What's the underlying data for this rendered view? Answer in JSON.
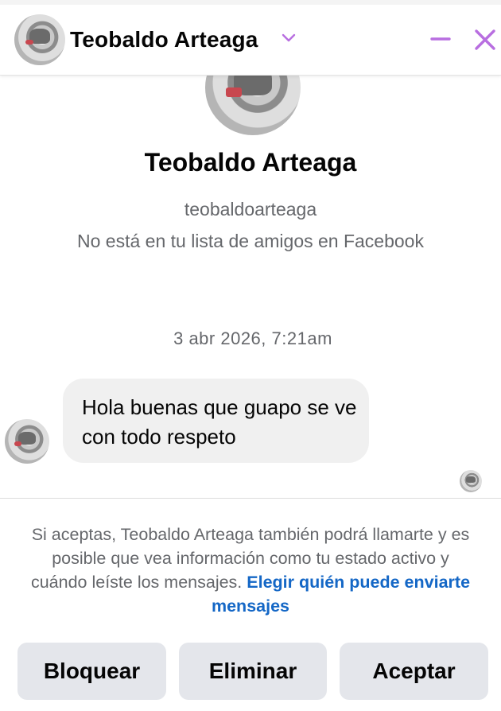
{
  "header": {
    "contact_name": "Teobaldo Arteaga",
    "chevron_icon": "chevron-down-icon",
    "minimize_icon": "minimize-icon",
    "close_icon": "close-icon",
    "accent_color": "#b86ee0"
  },
  "profile": {
    "name": "Teobaldo Arteaga",
    "username": "teobaldoarteaga",
    "relationship_note": "No está en tu lista de amigos en Facebook"
  },
  "conversation": {
    "timestamp": "3 abr 2026, 7:21am",
    "messages": [
      {
        "text": "Hola buenas que guapo se ve con todo respeto",
        "direction": "incoming"
      }
    ],
    "read_receipt": "avatar"
  },
  "request_notice": {
    "text": "Si aceptas, Teobaldo Arteaga también podrá llamarte y es posible que vea información como tu estado activo y cuándo leíste los mensajes. ",
    "link_text": "Elegir quién puede enviarte mensajes",
    "link_color": "#1467c6"
  },
  "actions": {
    "block_label": "Bloquear",
    "delete_label": "Eliminar",
    "accept_label": "Aceptar"
  }
}
